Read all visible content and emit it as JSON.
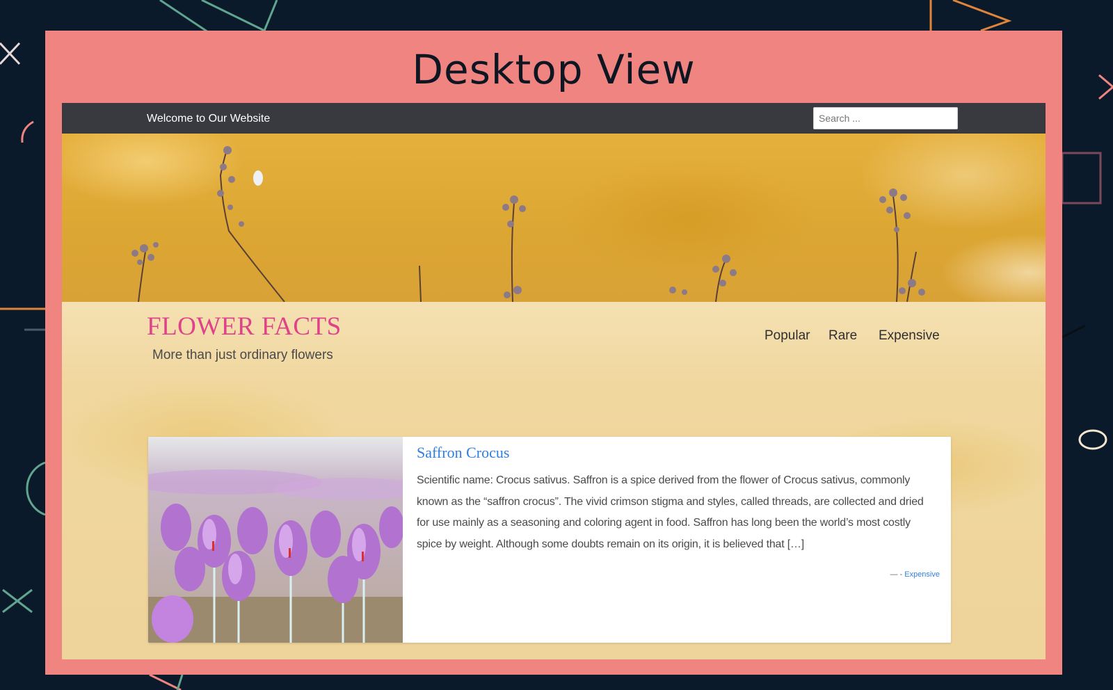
{
  "presentation": {
    "title": "Desktop View"
  },
  "topbar": {
    "welcome_text": "Welcome to Our Website",
    "search_placeholder": "Search ..."
  },
  "site": {
    "title": "FLOWER FACTS",
    "tagline": "More than just ordinary flowers"
  },
  "nav": {
    "items": [
      "Popular",
      "Rare",
      "Expensive"
    ]
  },
  "post": {
    "title": "Saffron Crocus",
    "excerpt": "Scientific name: Crocus sativus. Saffron is a spice derived from the flower of Crocus sativus, commonly known as the “saffron crocus”. The vivid crimson stigma and styles, called threads, are collected and dried for use mainly as a seasoning and coloring agent in food. Saffron has long been the world’s most costly spice by weight. Although some doubts remain on its origin, it is believed that […]",
    "meta_dash": "—",
    "meta_sep": " - ",
    "category": "Expensive"
  },
  "colors": {
    "page_background": "#0b1a2a",
    "frame": "#f08480",
    "topbar": "#383a40",
    "site_title": "#e0428a",
    "link_blue": "#2f7fe0"
  }
}
